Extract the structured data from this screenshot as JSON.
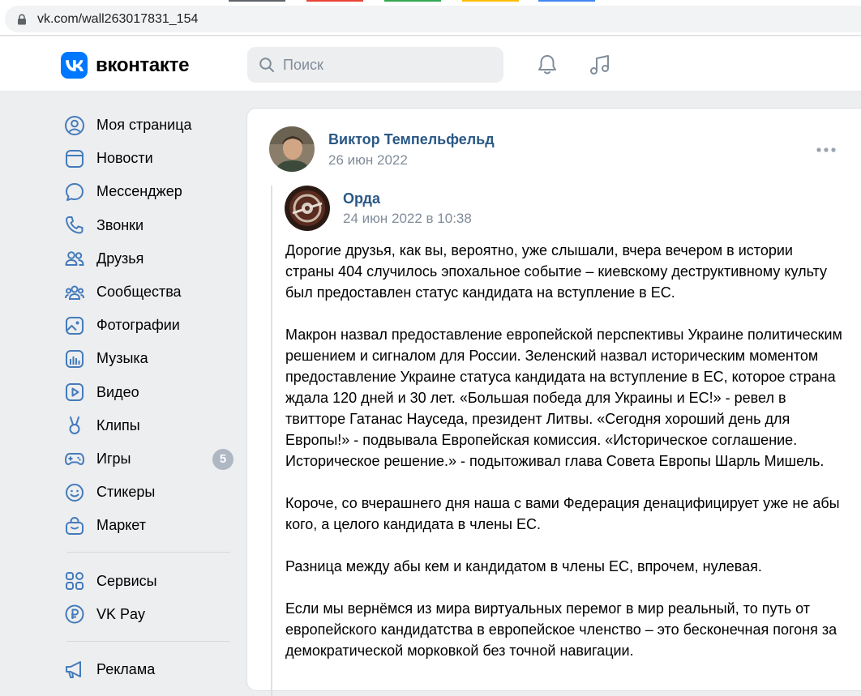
{
  "browser": {
    "url": "vk.com/wall263017831_154"
  },
  "header": {
    "logo_text": "вконтакте",
    "search_placeholder": "Поиск"
  },
  "sidebar": {
    "items": [
      {
        "label": "Моя страница",
        "icon": "user-circle-icon"
      },
      {
        "label": "Новости",
        "icon": "news-icon"
      },
      {
        "label": "Мессенджер",
        "icon": "message-icon"
      },
      {
        "label": "Звонки",
        "icon": "phone-icon"
      },
      {
        "label": "Друзья",
        "icon": "friends-icon"
      },
      {
        "label": "Сообщества",
        "icon": "communities-icon"
      },
      {
        "label": "Фотографии",
        "icon": "photo-icon"
      },
      {
        "label": "Музыка",
        "icon": "music-icon"
      },
      {
        "label": "Видео",
        "icon": "video-icon"
      },
      {
        "label": "Клипы",
        "icon": "clips-icon"
      },
      {
        "label": "Игры",
        "icon": "gamepad-icon",
        "badge": "5"
      },
      {
        "label": "Стикеры",
        "icon": "smile-icon"
      },
      {
        "label": "Маркет",
        "icon": "market-bag-icon"
      }
    ],
    "items2": [
      {
        "label": "Сервисы",
        "icon": "services-grid-icon"
      },
      {
        "label": "VK Pay",
        "icon": "vkpay-icon"
      }
    ],
    "items3": [
      {
        "label": "Реклама",
        "icon": "megaphone-icon"
      }
    ]
  },
  "post": {
    "author": "Виктор Темпельфельд",
    "date": "26 июн 2022",
    "repost": {
      "author": "Орда",
      "date": "24 июн 2022 в 10:38",
      "paragraphs": [
        "Дорогие друзья, как вы, вероятно, уже слышали, вчера вечером в истории страны 404 случилось эпохальное событие – киевскому деструктивному культу был предоставлен статус кандидата на вступление в ЕС.",
        "Макрон назвал предоставление европейской перспективы Украине политическим решением и сигналом для России. Зеленский назвал историческим моментом предоставление Украине статуса кандидата на вступление в ЕС, которое страна ждала 120 дней и 30 лет. «Большая победа для Украины и ЕС!» - ревел в твитторе Гатанас Науседа, президент Литвы. «Сегодня хороший день для Европы!» - подвывала Европейская комиссия. «Историческое соглашение. Историческое решение.» - подытоживал глава Совета Европы Шарль Мишель.",
        "Короче, со вчерашнего дня наша с вами Федерация денацифицирует уже не абы кого, а целого кандидата в члены ЕС.",
        "Разница между абы кем и кандидатом в члены ЕС, впрочем, нулевая.",
        "Если мы вернёмся из мира виртуальных перемог в мир реальный, то путь от европейского кандидатства в европейское членство – это бесконечная погоня за демократической морковкой без точной навигации."
      ]
    }
  },
  "colors": {
    "accent": "#0077ff",
    "link": "#2a5885",
    "muted": "#818c99",
    "icon": "#447bba"
  }
}
